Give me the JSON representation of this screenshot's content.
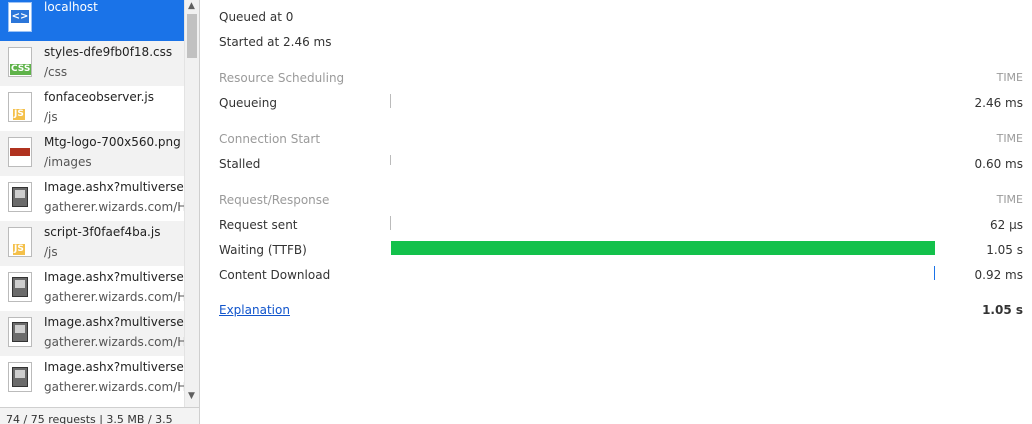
{
  "requests": [
    {
      "name": "localhost",
      "path": "",
      "icon": "html-document-icon",
      "badge": "<>",
      "selected": true
    },
    {
      "name": "styles-dfe9fb0f18.css",
      "path": "/css",
      "icon": "css-file-icon",
      "badge": "CSS"
    },
    {
      "name": "fonfaceobserver.js",
      "path": "/js",
      "icon": "js-file-icon",
      "badge": "JS"
    },
    {
      "name": "Mtg-logo-700x560.png",
      "path": "/images",
      "icon": "image-thumbnail-icon",
      "badge": ""
    },
    {
      "name": "Image.ashx?multiverseic",
      "path": "gatherer.wizards.com/H",
      "icon": "card-thumbnail-icon",
      "badge": ""
    },
    {
      "name": "script-3f0faef4ba.js",
      "path": "/js",
      "icon": "js-file-icon",
      "badge": "JS"
    },
    {
      "name": "Image.ashx?multiverseic",
      "path": "gatherer.wizards.com/H",
      "icon": "card-thumbnail-icon",
      "badge": ""
    },
    {
      "name": "Image.ashx?multiverseic",
      "path": "gatherer.wizards.com/H",
      "icon": "card-thumbnail-icon",
      "badge": ""
    },
    {
      "name": "Image.ashx?multiverseic",
      "path": "gatherer.wizards.com/H",
      "icon": "card-thumbnail-icon",
      "badge": ""
    }
  ],
  "status": "74 / 75 requests | 3.5 MB / 3.5",
  "queued": "Queued at 0",
  "started": "Started at 2.46 ms",
  "sections": [
    {
      "title": "Resource Scheduling",
      "time_label": "TIME",
      "rows": [
        {
          "label": "Queueing",
          "value": "2.46 ms"
        }
      ]
    },
    {
      "title": "Connection Start",
      "time_label": "TIME",
      "rows": [
        {
          "label": "Stalled",
          "value": "0.60 ms"
        }
      ]
    },
    {
      "title": "Request/Response",
      "time_label": "TIME",
      "rows": [
        {
          "label": "Request sent",
          "value": "62 µs"
        },
        {
          "label": "Waiting (TTFB)",
          "value": "1.05 s"
        },
        {
          "label": "Content Download",
          "value": "0.92 ms"
        }
      ]
    }
  ],
  "explanation": "Explanation",
  "total": "1.05 s",
  "colors": {
    "selected": "#1a73e8",
    "ttfb_bar": "#13c14b",
    "download_tick": "#1a73e8"
  }
}
